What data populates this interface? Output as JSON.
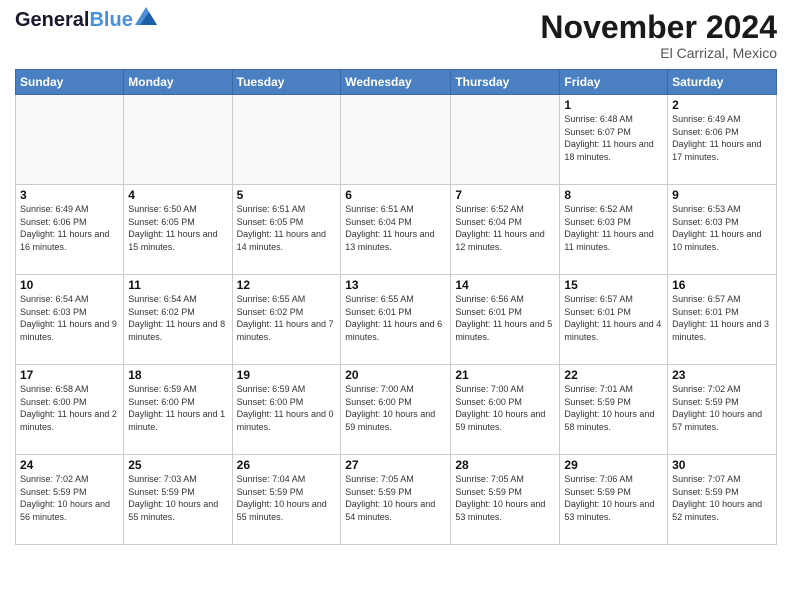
{
  "header": {
    "logo_general": "General",
    "logo_blue": "Blue",
    "month": "November 2024",
    "location": "El Carrizal, Mexico"
  },
  "weekdays": [
    "Sunday",
    "Monday",
    "Tuesday",
    "Wednesday",
    "Thursday",
    "Friday",
    "Saturday"
  ],
  "weeks": [
    [
      {
        "day": "",
        "info": ""
      },
      {
        "day": "",
        "info": ""
      },
      {
        "day": "",
        "info": ""
      },
      {
        "day": "",
        "info": ""
      },
      {
        "day": "",
        "info": ""
      },
      {
        "day": "1",
        "info": "Sunrise: 6:48 AM\nSunset: 6:07 PM\nDaylight: 11 hours\nand 18 minutes."
      },
      {
        "day": "2",
        "info": "Sunrise: 6:49 AM\nSunset: 6:06 PM\nDaylight: 11 hours\nand 17 minutes."
      }
    ],
    [
      {
        "day": "3",
        "info": "Sunrise: 6:49 AM\nSunset: 6:06 PM\nDaylight: 11 hours\nand 16 minutes."
      },
      {
        "day": "4",
        "info": "Sunrise: 6:50 AM\nSunset: 6:05 PM\nDaylight: 11 hours\nand 15 minutes."
      },
      {
        "day": "5",
        "info": "Sunrise: 6:51 AM\nSunset: 6:05 PM\nDaylight: 11 hours\nand 14 minutes."
      },
      {
        "day": "6",
        "info": "Sunrise: 6:51 AM\nSunset: 6:04 PM\nDaylight: 11 hours\nand 13 minutes."
      },
      {
        "day": "7",
        "info": "Sunrise: 6:52 AM\nSunset: 6:04 PM\nDaylight: 11 hours\nand 12 minutes."
      },
      {
        "day": "8",
        "info": "Sunrise: 6:52 AM\nSunset: 6:03 PM\nDaylight: 11 hours\nand 11 minutes."
      },
      {
        "day": "9",
        "info": "Sunrise: 6:53 AM\nSunset: 6:03 PM\nDaylight: 11 hours\nand 10 minutes."
      }
    ],
    [
      {
        "day": "10",
        "info": "Sunrise: 6:54 AM\nSunset: 6:03 PM\nDaylight: 11 hours\nand 9 minutes."
      },
      {
        "day": "11",
        "info": "Sunrise: 6:54 AM\nSunset: 6:02 PM\nDaylight: 11 hours\nand 8 minutes."
      },
      {
        "day": "12",
        "info": "Sunrise: 6:55 AM\nSunset: 6:02 PM\nDaylight: 11 hours\nand 7 minutes."
      },
      {
        "day": "13",
        "info": "Sunrise: 6:55 AM\nSunset: 6:01 PM\nDaylight: 11 hours\nand 6 minutes."
      },
      {
        "day": "14",
        "info": "Sunrise: 6:56 AM\nSunset: 6:01 PM\nDaylight: 11 hours\nand 5 minutes."
      },
      {
        "day": "15",
        "info": "Sunrise: 6:57 AM\nSunset: 6:01 PM\nDaylight: 11 hours\nand 4 minutes."
      },
      {
        "day": "16",
        "info": "Sunrise: 6:57 AM\nSunset: 6:01 PM\nDaylight: 11 hours\nand 3 minutes."
      }
    ],
    [
      {
        "day": "17",
        "info": "Sunrise: 6:58 AM\nSunset: 6:00 PM\nDaylight: 11 hours\nand 2 minutes."
      },
      {
        "day": "18",
        "info": "Sunrise: 6:59 AM\nSunset: 6:00 PM\nDaylight: 11 hours\nand 1 minute."
      },
      {
        "day": "19",
        "info": "Sunrise: 6:59 AM\nSunset: 6:00 PM\nDaylight: 11 hours\nand 0 minutes."
      },
      {
        "day": "20",
        "info": "Sunrise: 7:00 AM\nSunset: 6:00 PM\nDaylight: 10 hours\nand 59 minutes."
      },
      {
        "day": "21",
        "info": "Sunrise: 7:00 AM\nSunset: 6:00 PM\nDaylight: 10 hours\nand 59 minutes."
      },
      {
        "day": "22",
        "info": "Sunrise: 7:01 AM\nSunset: 5:59 PM\nDaylight: 10 hours\nand 58 minutes."
      },
      {
        "day": "23",
        "info": "Sunrise: 7:02 AM\nSunset: 5:59 PM\nDaylight: 10 hours\nand 57 minutes."
      }
    ],
    [
      {
        "day": "24",
        "info": "Sunrise: 7:02 AM\nSunset: 5:59 PM\nDaylight: 10 hours\nand 56 minutes."
      },
      {
        "day": "25",
        "info": "Sunrise: 7:03 AM\nSunset: 5:59 PM\nDaylight: 10 hours\nand 55 minutes."
      },
      {
        "day": "26",
        "info": "Sunrise: 7:04 AM\nSunset: 5:59 PM\nDaylight: 10 hours\nand 55 minutes."
      },
      {
        "day": "27",
        "info": "Sunrise: 7:05 AM\nSunset: 5:59 PM\nDaylight: 10 hours\nand 54 minutes."
      },
      {
        "day": "28",
        "info": "Sunrise: 7:05 AM\nSunset: 5:59 PM\nDaylight: 10 hours\nand 53 minutes."
      },
      {
        "day": "29",
        "info": "Sunrise: 7:06 AM\nSunset: 5:59 PM\nDaylight: 10 hours\nand 53 minutes."
      },
      {
        "day": "30",
        "info": "Sunrise: 7:07 AM\nSunset: 5:59 PM\nDaylight: 10 hours\nand 52 minutes."
      }
    ]
  ]
}
